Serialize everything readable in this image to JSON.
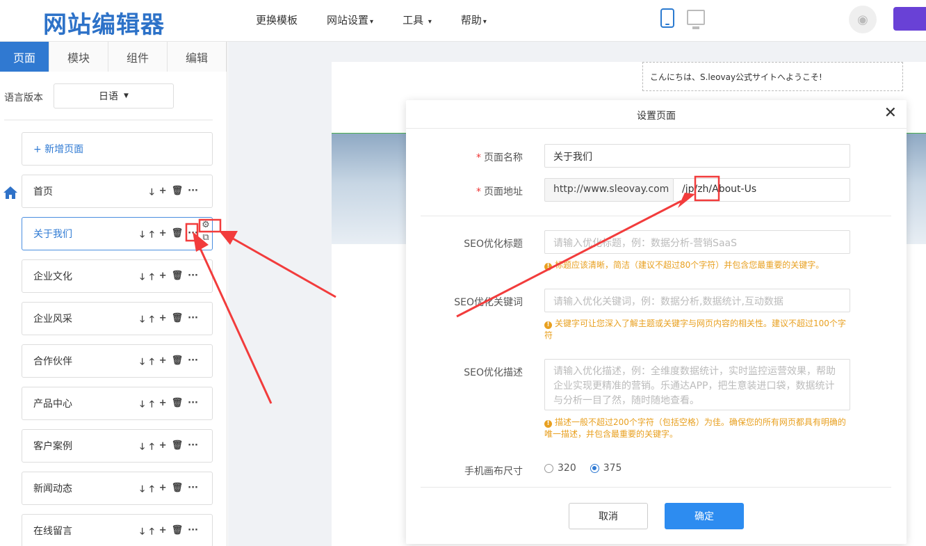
{
  "header": {
    "logo": "网站编辑器",
    "nav": [
      "更换模板",
      "网站设置",
      "工具",
      "帮助"
    ],
    "nav_dropdown": [
      false,
      true,
      true,
      true
    ]
  },
  "sidebar": {
    "tabs": [
      "页面",
      "模块",
      "组件",
      "编辑"
    ],
    "language_label": "语言版本",
    "language_value": "日语",
    "add_page": "+ 新增页面",
    "pages": [
      "首页",
      "关于我们",
      "企业文化",
      "企业风采",
      "合作伙伴",
      "产品中心",
      "客户案例",
      "新闻动态",
      "在线留言"
    ],
    "active_page": 1
  },
  "canvas": {
    "welcome_text": "こんにちは、S.leovay公式サイトへようこそ!"
  },
  "modal": {
    "title": "设置页面",
    "page_name_label": "页面名称",
    "page_name_value": "关于我们",
    "page_url_label": "页面地址",
    "url_prefix": "http://www.sleovay.com",
    "url_path": "/jp/zh/About-Us",
    "seo_title_label": "SEO优化标题",
    "seo_title_placeholder": "请输入优化标题，例：数据分析-营销SaaS",
    "seo_title_hint": "标题应该清晰，简洁（建议不超过80个字符）并包含您最重要的关键字。",
    "seo_keywords_label": "SEO优化关键词",
    "seo_keywords_placeholder": "请输入优化关键词，例：数据分析,数据统计,互动数据",
    "seo_keywords_hint": "关键字可让您深入了解主题或关键字与网页内容的相关性。建议不超过100个字符",
    "seo_desc_label": "SEO优化描述",
    "seo_desc_placeholder": "请输入优化描述，例：全维度数据统计，实时监控运营效果，帮助企业实现更精准的营销。乐通达APP，把生意装进口袋，数据统计与分析一目了然，随时随地查看。",
    "seo_desc_hint": "描述一般不超过200个字符（包括空格）为佳。确保您的所有网页都具有明确的唯一描述，并包含最重要的关键字。",
    "canvas_size_label": "手机画布尺寸",
    "canvas_options": [
      "320",
      "375"
    ],
    "canvas_selected": "375",
    "cancel_label": "取消",
    "ok_label": "确定"
  },
  "colors": {
    "primary": "#2f7ad3",
    "tab_active": "#3079d1",
    "warning": "#e8a020",
    "annotation_red": "#f23c3c",
    "purple": "#6941d6"
  }
}
